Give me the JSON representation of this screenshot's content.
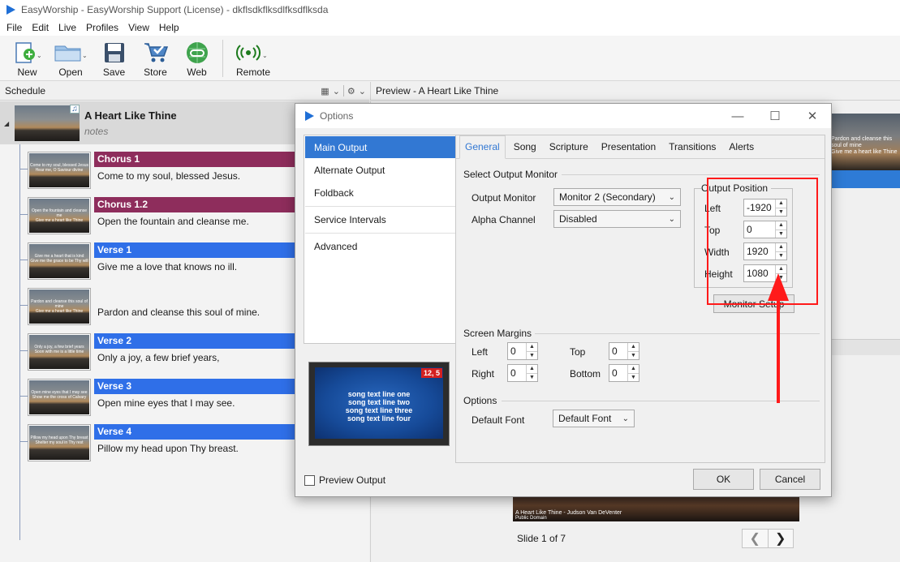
{
  "window": {
    "title": "EasyWorship - EasyWorship Support (License) - dkflsdkflksdlfksdflksda"
  },
  "menu": [
    "File",
    "Edit",
    "Live",
    "Profiles",
    "View",
    "Help"
  ],
  "toolbar": {
    "new": "New",
    "open": "Open",
    "save": "Save",
    "store": "Store",
    "web": "Web",
    "remote": "Remote"
  },
  "schedule": {
    "title": "Schedule",
    "song": {
      "title": "A Heart Like Thine",
      "notes": "notes"
    },
    "slides": [
      {
        "label": "Chorus 1",
        "lyric": "Come to my soul, blessed Jesus.",
        "color": "#8e2d5c",
        "thumb": "Come to my soul, blessed Jesus\nHear me, O Saviour divine"
      },
      {
        "label": "Chorus 1.2",
        "lyric": "Open the fountain and cleanse me.",
        "color": "#8e2d5c",
        "thumb": "Open the fountain and cleanse me\nGive me a heart like Thine"
      },
      {
        "label": "Verse 1",
        "lyric": "Give me a love that knows no ill.",
        "color": "#2f6fe8",
        "thumb": "Give me a heart that is kind\nGive me the grace to be Thy will"
      },
      {
        "label": "",
        "lyric": "Pardon and cleanse this soul of mine.",
        "color": "",
        "thumb": "Pardon and cleanse this soul of mine\nGive me a heart like Thine"
      },
      {
        "label": "Verse 2",
        "lyric": "Only a joy, a few brief years,",
        "color": "#2f6fe8",
        "thumb": "Only a joy, a few brief years\nSoon with me is a little time"
      },
      {
        "label": "Verse 3",
        "lyric": "Open mine eyes that I may see.",
        "color": "#2f6fe8",
        "thumb": "Open mine eyes that I may see\nShow me the cross of Calvary"
      },
      {
        "label": "Verse 4",
        "lyric": "Pillow my head upon Thy breast.",
        "color": "#2f6fe8",
        "thumb": "Pillow my head upon Thy breast\nShelter my soul in Thy rest"
      }
    ]
  },
  "preview": {
    "header": "Preview - A Heart Like Thine",
    "strip_text": "Pardon and cleanse this soul of mine\nGive me a heart like Thine",
    "bottom_title": "A Heart Like Thine - Judson Van DeVenter",
    "bottom_sub": "Public Domain",
    "slide_count": "Slide 1 of 7"
  },
  "dialog": {
    "title": "Options",
    "nav": [
      "Main Output",
      "Alternate Output",
      "Foldback",
      "Service Intervals",
      "Advanced"
    ],
    "tabs": [
      "General",
      "Song",
      "Scripture",
      "Presentation",
      "Transitions",
      "Alerts"
    ],
    "select_output_monitor": "Select Output Monitor",
    "output_monitor_label": "Output Monitor",
    "output_monitor_value": "Monitor 2 (Secondary)",
    "alpha_channel_label": "Alpha Channel",
    "alpha_channel_value": "Disabled",
    "output_position": {
      "title": "Output Position",
      "left_label": "Left",
      "left_value": "-1920",
      "top_label": "Top",
      "top_value": "0",
      "width_label": "Width",
      "width_value": "1920",
      "height_label": "Height",
      "height_value": "1080"
    },
    "monitor_setup": "Monitor Setup",
    "screen_margins": {
      "title": "Screen Margins",
      "left_label": "Left",
      "left_value": "0",
      "top_label": "Top",
      "top_value": "0",
      "right_label": "Right",
      "right_value": "0",
      "bottom_label": "Bottom",
      "bottom_value": "0"
    },
    "options_title": "Options",
    "default_font_label": "Default Font",
    "default_font_value": "Default Font",
    "monitor_preview_lines": [
      "song text line one",
      "song text line two",
      "song text line three",
      "song text line four"
    ],
    "monitor_badge": "12, 5",
    "preview_output_label": "Preview Output",
    "ok": "OK",
    "cancel": "Cancel"
  },
  "colors": {
    "accent": "#3278d3",
    "annotation": "#ff1a1a"
  }
}
